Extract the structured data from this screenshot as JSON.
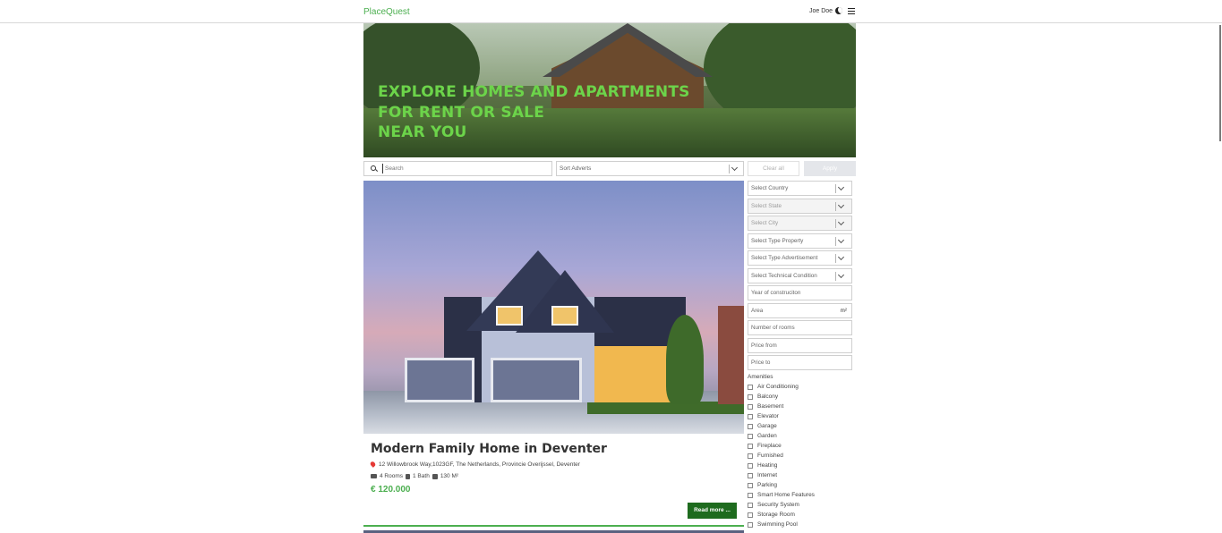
{
  "header": {
    "brand": "PlaceQuest",
    "user_name": "Joe Doe",
    "theme_icon": "moon-icon",
    "menu_icon": "hamburger-menu-icon"
  },
  "hero": {
    "title_lines": [
      "EXPLORE HOMES AND APARTMENTS",
      "FOR RENT OR SALE",
      "NEAR YOU"
    ]
  },
  "toolbar": {
    "search_placeholder": "Search",
    "sort_label": "Sort Adverts",
    "clear_label": "Clear all",
    "apply_label": "Apply"
  },
  "listing": {
    "title": "Modern Family Home in Deventer",
    "address": "12 Willowbrook Way,1023GF, The Netherlands, Provincie Overijssel, Deventer",
    "rooms": "4 Rooms",
    "baths": "1 Bath",
    "area": "130 M²",
    "price": "€ 120.000",
    "read_more": "Read more ..."
  },
  "filters": {
    "country": "Select Country",
    "state": "Select State",
    "city": "Select City",
    "type_property": "Select Type Property",
    "type_advertisement": "Select Type Advertisement",
    "technical_condition": "Select Technical Condition",
    "year_placeholder": "Year of construciton",
    "area_placeholder": "Area",
    "area_unit": "m²",
    "rooms_placeholder": "Number of rooms",
    "price_from_placeholder": "Price from",
    "price_to_placeholder": "Price to"
  },
  "amenities": {
    "title": "Amenities",
    "items": [
      "Air Conditioning",
      "Balcony",
      "Basement",
      "Elevator",
      "Garage",
      "Garden",
      "Fireplace",
      "Furnished",
      "Heating",
      "Internet",
      "Parking",
      "Smart Home Features",
      "Security System",
      "Storage Room",
      "Swimming Pool"
    ]
  },
  "colors": {
    "brand_green": "#4caf50",
    "hero_text": "#6cd44a",
    "button_green": "#1e6b1e"
  }
}
